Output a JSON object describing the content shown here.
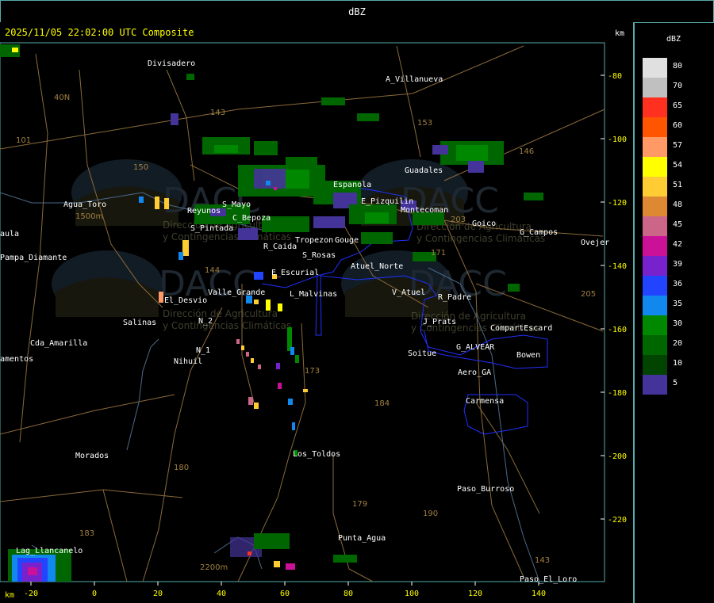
{
  "window": {
    "title": "dBZ"
  },
  "header": {
    "timestamp": "2025/11/05 22:02:00 UTC Composite",
    "units_label": "km"
  },
  "axes": {
    "x_unit": "km",
    "x_ticks": [
      -20,
      0,
      20,
      40,
      60,
      80,
      100,
      120,
      140
    ],
    "y_ticks": [
      -80,
      -100,
      -120,
      -140,
      -160,
      -180,
      -200,
      -220
    ]
  },
  "legend": {
    "title": "dBZ",
    "entries": [
      {
        "label": "80",
        "color": "#e0e0e0"
      },
      {
        "label": "70",
        "color": "#c0c0c0"
      },
      {
        "label": "65",
        "color": "#ff3020"
      },
      {
        "label": "60",
        "color": "#ff5500"
      },
      {
        "label": "57",
        "color": "#ff9966"
      },
      {
        "label": "54",
        "color": "#ffff00"
      },
      {
        "label": "51",
        "color": "#ffcc33"
      },
      {
        "label": "48",
        "color": "#dd8833"
      },
      {
        "label": "45",
        "color": "#cc6688"
      },
      {
        "label": "42",
        "color": "#cc1199"
      },
      {
        "label": "39",
        "color": "#7722cc"
      },
      {
        "label": "36",
        "color": "#2244ff"
      },
      {
        "label": "35",
        "color": "#1188ee"
      },
      {
        "label": "30",
        "color": "#008800"
      },
      {
        "label": "20",
        "color": "#006600"
      },
      {
        "label": "10",
        "color": "#004400"
      },
      {
        "label": "5",
        "color": "#443399"
      }
    ]
  },
  "places": [
    {
      "name": "Divisadero"
    },
    {
      "name": "A_Villanueva"
    },
    {
      "name": "Guadales"
    },
    {
      "name": "Agua_Toro"
    },
    {
      "name": "1500m"
    },
    {
      "name": "Reyunos"
    },
    {
      "name": "S_Mayo"
    },
    {
      "name": "C_Bepoza"
    },
    {
      "name": "S_Pintada"
    },
    {
      "name": "R_Caida"
    },
    {
      "name": "S_Rosas"
    },
    {
      "name": "Atuel_Norte"
    },
    {
      "name": "E_Escurial"
    },
    {
      "name": "Valle_Grande"
    },
    {
      "name": "L_Malvinas"
    },
    {
      "name": "V_Atuel"
    },
    {
      "name": "R_Padre"
    },
    {
      "name": "El_Desvio"
    },
    {
      "name": "Salinas"
    },
    {
      "name": "N_2"
    },
    {
      "name": "N_1"
    },
    {
      "name": "Nihuil"
    },
    {
      "name": "Cda_Amarilla"
    },
    {
      "name": "amentos"
    },
    {
      "name": "Pampa_Diamante"
    },
    {
      "name": "aula"
    },
    {
      "name": "Goico"
    },
    {
      "name": "G_Campos"
    },
    {
      "name": "Ovejer"
    },
    {
      "name": "J_Prats"
    },
    {
      "name": "CompartEscard"
    },
    {
      "name": "G_ALVEAR"
    },
    {
      "name": "Soitue"
    },
    {
      "name": "Bowen"
    },
    {
      "name": "Aero_GA"
    },
    {
      "name": "Carmensa"
    },
    {
      "name": "Los_Toldos"
    },
    {
      "name": "Morados"
    },
    {
      "name": "Paso_Burroso"
    },
    {
      "name": "Punta_Agua"
    },
    {
      "name": "Lag_Llancanelo"
    },
    {
      "name": "Paso_El_Loro"
    },
    {
      "name": "2200m"
    },
    {
      "name": "Montecoman"
    },
    {
      "name": "E_Pizquilin"
    },
    {
      "name": "Espanola"
    },
    {
      "name": "Tropezon"
    },
    {
      "name": "Gouge"
    },
    {
      "name": "40N"
    },
    {
      "name": "101"
    },
    {
      "name": "150"
    },
    {
      "name": "143"
    },
    {
      "name": "153"
    },
    {
      "name": "146"
    },
    {
      "name": "203"
    },
    {
      "name": "171"
    },
    {
      "name": "144"
    },
    {
      "name": "173"
    },
    {
      "name": "184"
    },
    {
      "name": "180"
    },
    {
      "name": "179"
    },
    {
      "name": "190"
    },
    {
      "name": "183"
    },
    {
      "name": "143"
    },
    {
      "name": "205"
    }
  ],
  "watermark": {
    "logo": "DACC",
    "line1": "Dirección de Agricultura",
    "line2": "y Contingencias Climáticas"
  }
}
